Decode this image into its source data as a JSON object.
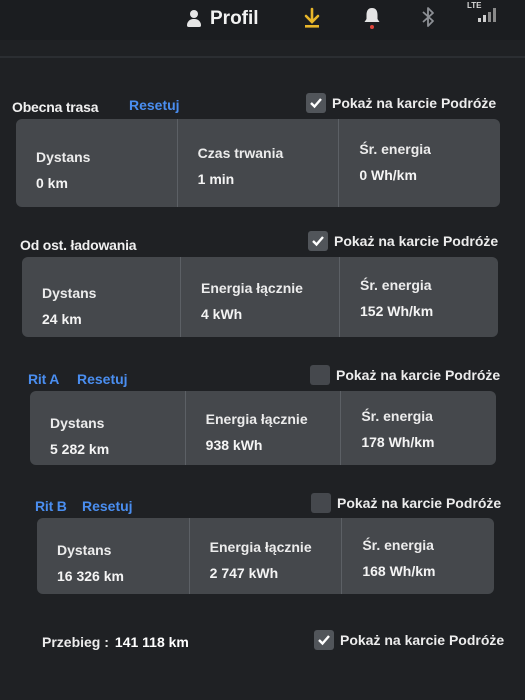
{
  "header": {
    "profile_label": "Profil",
    "network_label": "LTE",
    "icons": [
      "person-icon",
      "download-icon",
      "bell-icon",
      "bluetooth-icon",
      "signal-icon"
    ],
    "colors": {
      "download": "#e8b62a",
      "bell_dot": "#e0443a"
    }
  },
  "show_label": "Pokaż na karcie Podróże",
  "current_trip": {
    "title": "Obecna trasa",
    "reset": "Resetuj",
    "show_checked": true,
    "cells": [
      {
        "label": "Dystans",
        "value": "0 km"
      },
      {
        "label": "Czas trwania",
        "value": "1 min"
      },
      {
        "label": "Śr. energia",
        "value": "0 Wh/km"
      }
    ]
  },
  "since_charge": {
    "title": "Od ost. ładowania",
    "show_checked": true,
    "cells": [
      {
        "label": "Dystans",
        "value": "24 km"
      },
      {
        "label": "Energia łącznie",
        "value": "4 kWh"
      },
      {
        "label": "Śr. energia",
        "value": "152 Wh/km"
      }
    ]
  },
  "trip_a": {
    "title": "Rit A",
    "reset": "Resetuj",
    "show_checked": false,
    "cells": [
      {
        "label": "Dystans",
        "value": "5 282 km"
      },
      {
        "label": "Energia łącznie",
        "value": "938 kWh"
      },
      {
        "label": "Śr. energia",
        "value": "178 Wh/km"
      }
    ]
  },
  "trip_b": {
    "title": "Rit B",
    "reset": "Resetuj",
    "show_checked": false,
    "cells": [
      {
        "label": "Dystans",
        "value": "16 326 km"
      },
      {
        "label": "Energia łącznie",
        "value": "2 747 kWh"
      },
      {
        "label": "Śr. energia",
        "value": "168 Wh/km"
      }
    ]
  },
  "odometer": {
    "label": "Przebieg :",
    "value": "141 118 km",
    "show_checked": true
  },
  "colors": {
    "accent": "#4a8ef0",
    "card": "#45484c",
    "background": "#1f2124"
  }
}
